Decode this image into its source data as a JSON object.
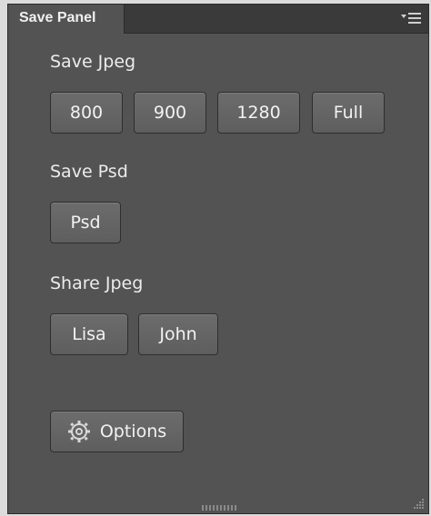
{
  "panel": {
    "tab_title": "Save Panel",
    "menu_icon": "panel-menu-icon"
  },
  "sections": {
    "save_jpeg": {
      "label": "Save Jpeg",
      "buttons": [
        "800",
        "900",
        "1280",
        "Full"
      ]
    },
    "save_psd": {
      "label": "Save Psd",
      "buttons": [
        "Psd"
      ]
    },
    "share_jpeg": {
      "label": "Share Jpeg",
      "buttons": [
        "Lisa",
        "John"
      ]
    }
  },
  "options": {
    "label": "Options",
    "icon": "gear-icon"
  },
  "colors": {
    "panel_bg": "#535353",
    "tab_bar_bg": "#3a3a3a",
    "button_bg": "#666666",
    "text": "#ececec"
  }
}
